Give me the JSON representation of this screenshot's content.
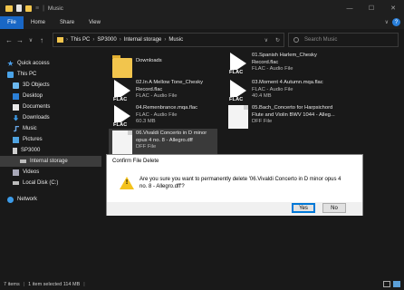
{
  "window": {
    "title": "Music",
    "separator": "|",
    "dropdown": "≡",
    "controls": [
      "—",
      "☐",
      "✕"
    ]
  },
  "ribbon": {
    "tabs": [
      "File",
      "Home",
      "Share",
      "View"
    ],
    "expand": "∨",
    "help": "?"
  },
  "nav_buttons": [
    "←",
    "→",
    "∨",
    "↑"
  ],
  "address": {
    "crumbs": [
      "This PC",
      "SP3000",
      "Internal storage",
      "Music"
    ],
    "sep": "›",
    "dropdown": "∨",
    "refresh": "↻"
  },
  "search": {
    "placeholder": "Search Music"
  },
  "nav_pane": {
    "items": [
      {
        "label": "Quick access"
      },
      {
        "label": "This PC"
      },
      {
        "label": "3D Objects"
      },
      {
        "label": "Desktop"
      },
      {
        "label": "Documents"
      },
      {
        "label": "Downloads"
      },
      {
        "label": "Music"
      },
      {
        "label": "Pictures"
      },
      {
        "label": "SP3000"
      },
      {
        "label": "Internal storage"
      },
      {
        "label": "Videos"
      },
      {
        "label": "Local Disk (C:)"
      },
      {
        "label": "Network"
      }
    ]
  },
  "files": [
    {
      "name": "Downloads",
      "type": "",
      "size": ""
    },
    {
      "name": "01.Spanish Harlem_Chesky Record.flac",
      "type": "FLAC - Audio File",
      "size": ""
    },
    {
      "name": "02.In A Mellow Tone_Chesky Record.flac",
      "type": "FLAC - Audio File",
      "size": ""
    },
    {
      "name": "03.Moment 4 Autumn.mqa.flac",
      "type": "FLAC - Audio File",
      "size": "40.4 MB"
    },
    {
      "name": "04.Remenbrance.mqa.flac",
      "type": "FLAC - Audio File",
      "size": "60.3 MB"
    },
    {
      "name": "05.Bach_Concerto for Harpsichord Flute and Violin BWV 1044 - Alleg...",
      "type": "DFF File",
      "size": ""
    },
    {
      "name": "06.Vivaldi Concerto in D minor opus 4 no. 8 - Allegro.dff",
      "type": "DFF File",
      "size": ""
    }
  ],
  "flac_label": "FLAC",
  "dialog": {
    "title": "Confirm File Delete",
    "message": "Are you sure you want to permanently delete '06.Vivaldi Concerto in D minor opus 4 no. 8 - Allegro.dff'?",
    "warn_mark": "!",
    "yes_label": "Yes",
    "no_label": "No"
  },
  "status": {
    "items": "7 items",
    "selected": "1 item selected  114 MB",
    "sep": "|"
  },
  "colors": {
    "accent": "#1967c6",
    "folder": "#f2c54d",
    "warning": "#f4c21b"
  }
}
